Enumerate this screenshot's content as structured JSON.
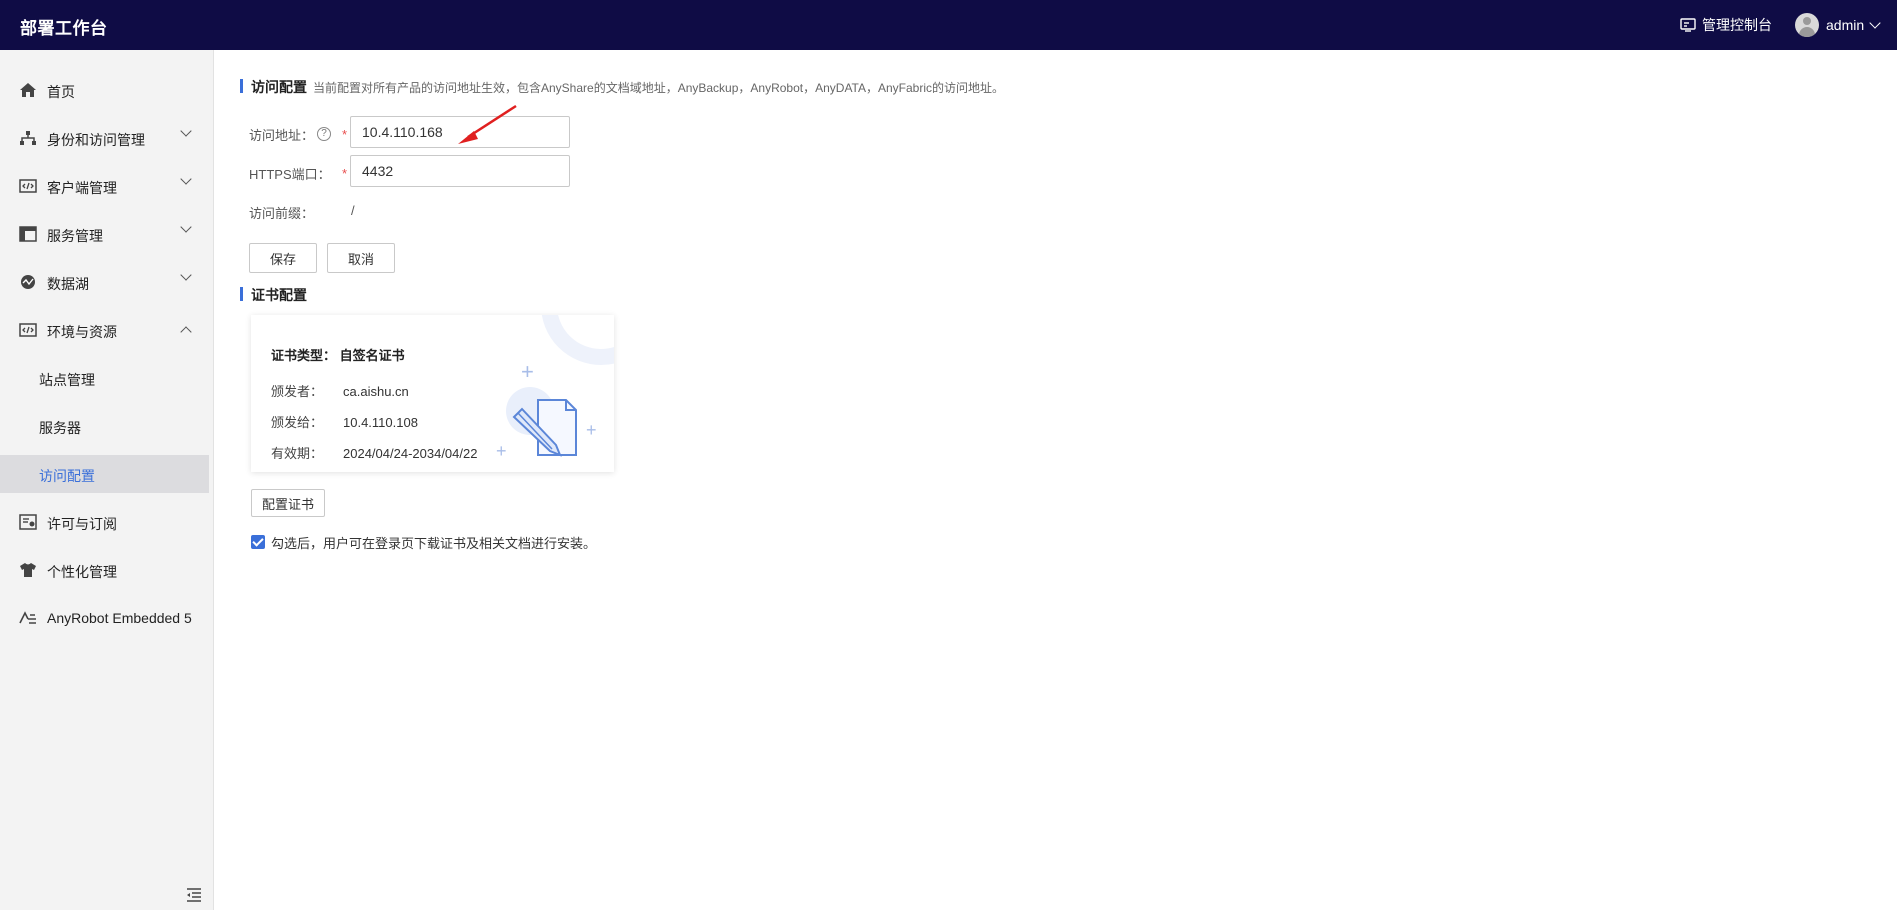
{
  "header": {
    "brand": "部署工作台",
    "console_label": "管理控制台",
    "user_name": "admin",
    "colors": {
      "topbar_bg": "#0f0c45",
      "accent": "#3a6fd9"
    }
  },
  "sidebar": {
    "items": [
      {
        "label": "首页",
        "icon": "home-icon"
      },
      {
        "label": "身份和访问管理",
        "icon": "org-tree-icon",
        "expandable": true
      },
      {
        "label": "客户端管理",
        "icon": "code-window-icon",
        "expandable": true
      },
      {
        "label": "服务管理",
        "icon": "layout-grid-icon",
        "expandable": true
      },
      {
        "label": "数据湖",
        "icon": "data-lake-icon",
        "expandable": true
      },
      {
        "label": "环境与资源",
        "icon": "code-window-icon",
        "expandable": true,
        "expanded": true
      },
      {
        "label": "站点管理"
      },
      {
        "label": "服务器"
      },
      {
        "label": "访问配置",
        "active": true
      },
      {
        "label": "许可与订阅",
        "icon": "license-icon"
      },
      {
        "label": "个性化管理",
        "icon": "shirt-icon"
      },
      {
        "label": "AnyRobot Embedded 5",
        "icon": "anyrobot-logo-icon"
      }
    ]
  },
  "access": {
    "title": "访问配置",
    "description": "当前配置对所有产品的访问地址生效，包含AnyShare的文档域地址，AnyBackup，AnyRobot，AnyDATA，AnyFabric的访问地址。",
    "address_label": "访问地址：",
    "address_value": "10.4.110.168",
    "port_label": "HTTPS端口：",
    "port_value": "4432",
    "prefix_label": "访问前缀：",
    "prefix_value": "/",
    "required_mark": "*",
    "help_mark": "?",
    "save_label": "保存",
    "cancel_label": "取消"
  },
  "cert": {
    "title": "证书配置",
    "type_line": "证书类型：  自签名证书",
    "issuer_label": "颁发者：",
    "issuer_value": "ca.aishu.cn",
    "issued_to_label": "颁发给：",
    "issued_to_value": "10.4.110.108",
    "validity_label": "有效期：",
    "validity_value": "2024/04/24-2034/04/22",
    "configure_label": "配置证书",
    "checkbox_checked": true,
    "checkbox_label": "勾选后，用户可在登录页下载证书及相关文档进行安装。"
  }
}
